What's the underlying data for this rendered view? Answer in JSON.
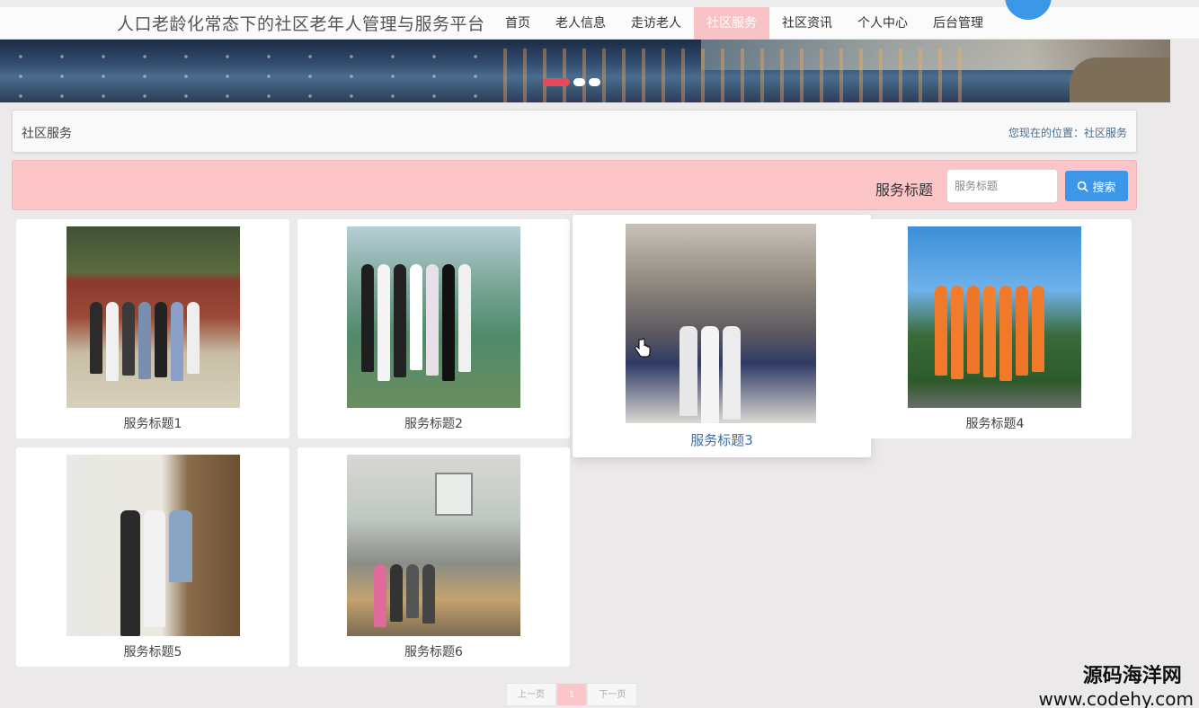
{
  "header": {
    "site_title": "人口老龄化常态下的社区老年人管理与服务平台",
    "nav": [
      {
        "label": "首页",
        "active": false
      },
      {
        "label": "老人信息",
        "active": false
      },
      {
        "label": "走访老人",
        "active": false
      },
      {
        "label": "社区服务",
        "active": true
      },
      {
        "label": "社区资讯",
        "active": false
      },
      {
        "label": "个人中心",
        "active": false
      },
      {
        "label": "后台管理",
        "active": false
      }
    ]
  },
  "banner": {
    "slide_count": 3,
    "active_slide": 1
  },
  "breadcrumb": {
    "title": "社区服务",
    "location_label": "您现在的位置：社区服务"
  },
  "search": {
    "label": "服务标题",
    "placeholder": "服务标题",
    "button_label": "搜索",
    "button_icon": "search-icon"
  },
  "services": [
    {
      "title": "服务标题1"
    },
    {
      "title": "服务标题2"
    },
    {
      "title": "服务标题3"
    },
    {
      "title": "服务标题4"
    },
    {
      "title": "服务标题5"
    },
    {
      "title": "服务标题6"
    }
  ],
  "pagination": {
    "prev_label": "上一页",
    "current_page": "1",
    "next_label": "下一页"
  },
  "watermark": {
    "line1": "源码海洋网",
    "line2": "www.codehy.com"
  },
  "colors": {
    "accent_blue": "#3d97e9",
    "pink_bar": "#fcc6c8",
    "active_nav": "#f7c3c6",
    "page_bg": "#ece9ea"
  }
}
